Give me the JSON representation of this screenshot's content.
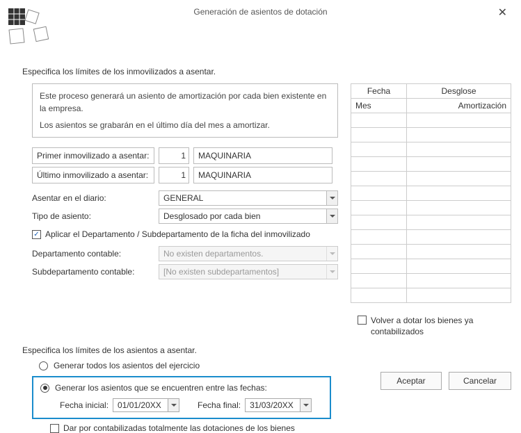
{
  "title": "Generación de asientos de dotación",
  "section1": "Especifica los límites de los inmovilizados a asentar.",
  "info": {
    "line1": "Este proceso generará un asiento de amortización por cada bien existente en la empresa.",
    "line2": "Los asientos se grabarán en el último día del mes a amortizar."
  },
  "rows": {
    "first_label": "Primer inmovilizado a asentar:",
    "first_num": "1",
    "first_name": "MAQUINARIA",
    "last_label": "Último inmovilizado a asentar:",
    "last_num": "1",
    "last_name": "MAQUINARIA",
    "diary_label": "Asentar en el diario:",
    "diary_value": "GENERAL",
    "type_label": "Tipo de asiento:",
    "type_value": "Desglosado por cada bien",
    "apply_dept": "Aplicar el Departamento / Subdepartamento de la ficha del inmovilizado",
    "dept_label": "Departamento contable:",
    "dept_value": "No existen departamentos.",
    "subdept_label": "Subdepartamento contable:",
    "subdept_value": "[No existen subdepartamentos]"
  },
  "section2": "Especifica los límites de los asientos a asentar.",
  "radios": {
    "all": "Generar todos los asientos del ejercicio",
    "between": "Generar los asientos que se encuentren entre las fechas:",
    "date_initial_label": "Fecha inicial:",
    "date_initial": "01/01/20XX",
    "date_final_label": "Fecha final:",
    "date_final": "31/03/20XX",
    "mark_done": "Dar por contabilizadas totalmente las dotaciones de los bienes"
  },
  "table": {
    "h1": "Fecha",
    "h2": "Desglose",
    "sub1": "Mes",
    "sub2": "Amortización"
  },
  "recheck": "Volver a dotar los bienes ya contabilizados",
  "buttons": {
    "ok": "Aceptar",
    "cancel": "Cancelar"
  }
}
